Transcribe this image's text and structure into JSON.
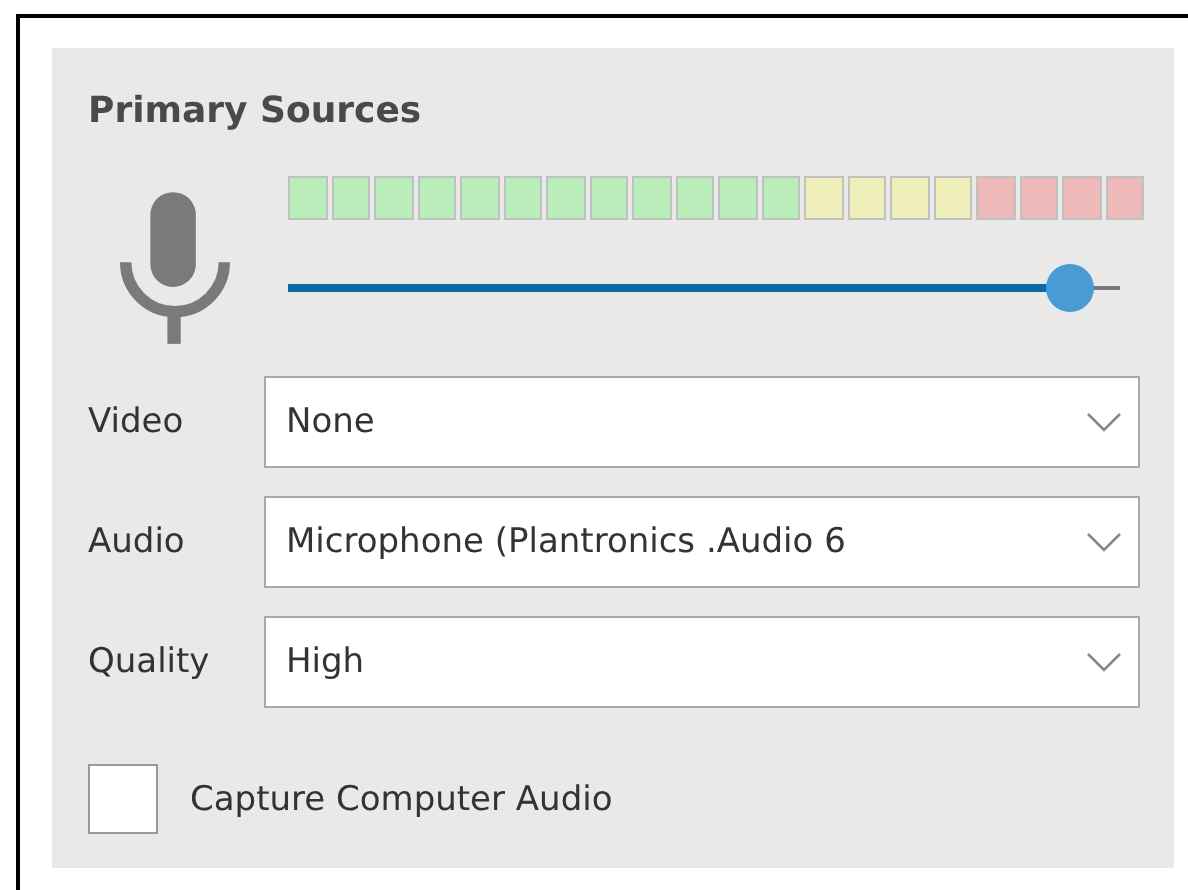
{
  "panel": {
    "title": "Primary Sources"
  },
  "meter": {
    "segments": [
      {
        "color": "#b9eeba"
      },
      {
        "color": "#b9eeba"
      },
      {
        "color": "#b9eeba"
      },
      {
        "color": "#b9eeba"
      },
      {
        "color": "#b9eeba"
      },
      {
        "color": "#b9eeba"
      },
      {
        "color": "#b9eeba"
      },
      {
        "color": "#b9eeba"
      },
      {
        "color": "#b9eeba"
      },
      {
        "color": "#b9eeba"
      },
      {
        "color": "#b9eeba"
      },
      {
        "color": "#b9eeba"
      },
      {
        "color": "#eeeeb9"
      },
      {
        "color": "#eeeeb9"
      },
      {
        "color": "#eeeeb9"
      },
      {
        "color": "#eeeeb9"
      },
      {
        "color": "#eeb9b9"
      },
      {
        "color": "#eeb9b9"
      },
      {
        "color": "#eeb9b9"
      },
      {
        "color": "#eeb9b9"
      }
    ]
  },
  "volume": {
    "level": 0.95
  },
  "fields": [
    {
      "label": "Video",
      "value": "None"
    },
    {
      "label": "Audio",
      "value": "Microphone (Plantronics .Audio 6"
    },
    {
      "label": "Quality",
      "value": "High"
    }
  ],
  "capture_audio": {
    "label": "Capture Computer Audio",
    "checked": false
  }
}
